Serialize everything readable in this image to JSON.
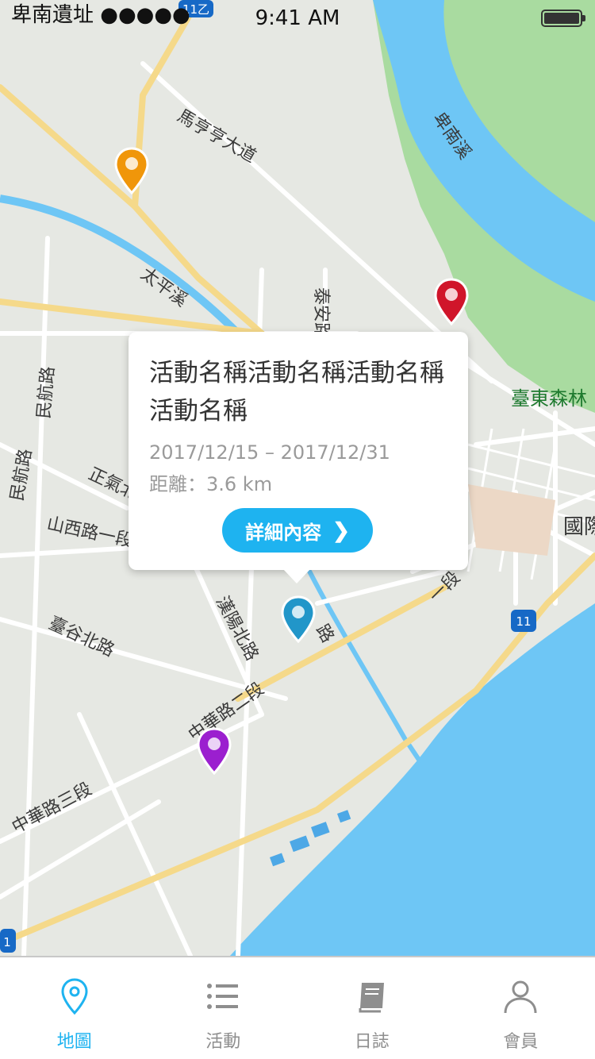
{
  "status_bar": {
    "carrier": "卑南遺址 ●●●●●",
    "time": "9:41 AM"
  },
  "map": {
    "labels": {
      "road_mating": "馬亨亨大道",
      "river_taiping": "太平溪",
      "river_beinan": "卑南溪",
      "road_taian": "泰安路",
      "road_minhang": "民航路",
      "road_minsheng": "民航路",
      "road_zhengqi": "正氣北",
      "road_shanxi": "山西路一段",
      "road_hanyang": "漢陽北路",
      "road_zhonghua2": "中華路二段",
      "road_zhonghua3": "中華路三段",
      "road_tainan": "臺谷北路",
      "forest": "臺東森林",
      "airport_area": "國際",
      "route_11b": "11乙",
      "route_11": "11",
      "route_1": "1",
      "road_xinsheng": "一段",
      "road_lu": "路"
    },
    "pins": [
      {
        "name": "orange-pin",
        "color": "#f0960a"
      },
      {
        "name": "red-pin",
        "color": "#d0152a"
      },
      {
        "name": "blue-pin",
        "color": "#2196c9"
      },
      {
        "name": "purple-pin",
        "color": "#9b1fcf"
      }
    ]
  },
  "popup": {
    "title": "活動名稱活動名稱活動名稱活動名稱",
    "dates": "2017/12/15 – 2017/12/31",
    "distance": "距離：3.6 km",
    "button_label": "詳細內容",
    "button_chevron": "❯"
  },
  "tabbar": {
    "active_color": "#1eb3f0",
    "items": [
      {
        "label": "地圖",
        "icon": "map-pin-icon",
        "active": true
      },
      {
        "label": "活動",
        "icon": "list-icon",
        "active": false
      },
      {
        "label": "日誌",
        "icon": "book-icon",
        "active": false
      },
      {
        "label": "會員",
        "icon": "person-icon",
        "active": false
      }
    ]
  }
}
